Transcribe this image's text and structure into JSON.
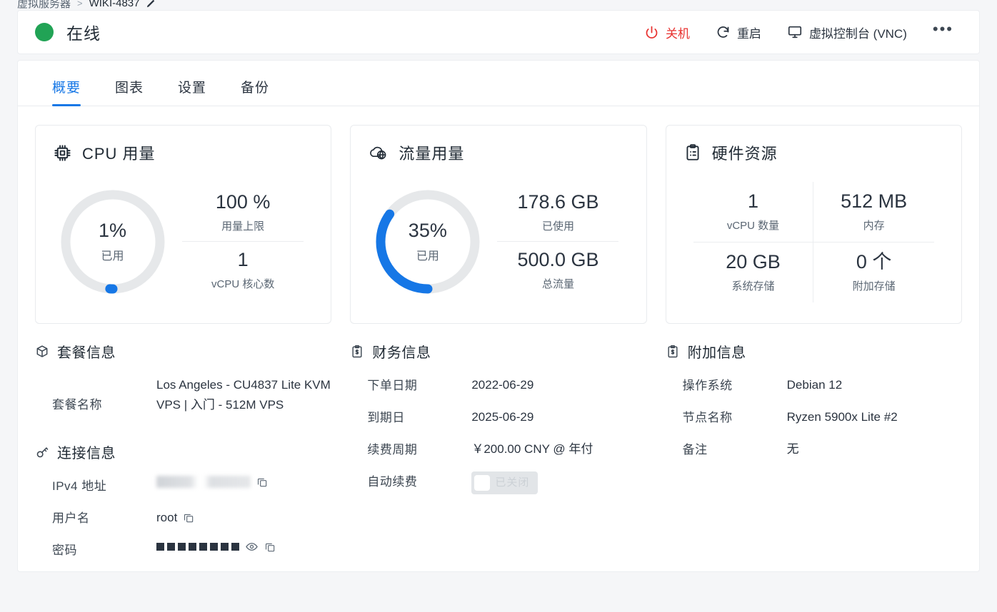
{
  "breadcrumb": {
    "parent": "虚拟服务器",
    "separator": ">",
    "current": "WIKI-4837",
    "edit_icon": "pencil-icon"
  },
  "status": {
    "state_label": "在线",
    "state_color": "#21a355",
    "actions": [
      {
        "label": "关机",
        "icon": "power-icon",
        "color": "#e8312f"
      },
      {
        "label": "重启",
        "icon": "refresh-icon",
        "color": "#2b3440"
      },
      {
        "label": "虚拟控制台 (VNC)",
        "icon": "monitor-icon",
        "color": "#2b3440"
      }
    ],
    "more_label": "•••"
  },
  "tabs": [
    {
      "label": "概要",
      "active": true
    },
    {
      "label": "图表",
      "active": false
    },
    {
      "label": "设置",
      "active": false
    },
    {
      "label": "备份",
      "active": false
    }
  ],
  "cards": {
    "cpu": {
      "title": "CPU 用量",
      "icon": "cpu-chip-icon",
      "donut": {
        "percent_text": "1%",
        "percent": 1,
        "caption": "已用",
        "color": "#1677e6",
        "track": "#e6e8ea"
      },
      "stats": [
        {
          "value": "100 %",
          "caption": "用量上限"
        },
        {
          "value": "1",
          "caption": "vCPU 核心数"
        }
      ]
    },
    "traffic": {
      "title": "流量用量",
      "icon": "cloud-globe-icon",
      "donut": {
        "percent_text": "35%",
        "percent": 35,
        "caption": "已用",
        "color": "#1677e6",
        "track": "#e6e8ea"
      },
      "stats": [
        {
          "value": "178.6 GB",
          "caption": "已使用"
        },
        {
          "value": "500.0 GB",
          "caption": "总流量"
        }
      ]
    },
    "hardware": {
      "title": "硬件资源",
      "icon": "clipboard-list-icon",
      "cells": [
        {
          "value": "1",
          "caption": "vCPU 数量"
        },
        {
          "value": "512 MB",
          "caption": "内存"
        },
        {
          "value": "20 GB",
          "caption": "系统存储"
        },
        {
          "value": "0 个",
          "caption": "附加存储"
        }
      ]
    }
  },
  "sections": {
    "package": {
      "title": "套餐信息",
      "icon": "package-box-icon",
      "rows": [
        {
          "key": "套餐名称",
          "value": "Los Angeles - CU4837 Lite KVM VPS | 入门 - 512M VPS"
        }
      ]
    },
    "connection": {
      "title": "连接信息",
      "icon": "key-icon",
      "rows": [
        {
          "key": "IPv4 地址",
          "value": "",
          "redacted": true,
          "copy_icon": "copy-icon"
        },
        {
          "key": "用户名",
          "value": "root",
          "copy_icon": "copy-icon"
        },
        {
          "key": "密码",
          "value": "••••••••",
          "masked_count": 8,
          "eye_icon": "eye-icon",
          "copy_icon": "copy-icon"
        }
      ]
    },
    "finance": {
      "title": "财务信息",
      "icon": "clipboard-dollar-icon",
      "rows": [
        {
          "key": "下单日期",
          "value": "2022-06-29"
        },
        {
          "key": "到期日",
          "value": "2025-06-29"
        },
        {
          "key": "续费周期",
          "value": "￥200.00 CNY @ 年付"
        },
        {
          "key": "自动续费",
          "value": "",
          "toggle": {
            "state_label": "已关闭",
            "on": false
          }
        }
      ]
    },
    "extra": {
      "title": "附加信息",
      "icon": "clipboard-dollar-icon",
      "rows": [
        {
          "key": "操作系统",
          "value": "Debian 12"
        },
        {
          "key": "节点名称",
          "value": "Ryzen 5900x Lite #2"
        },
        {
          "key": "备注",
          "value": "无"
        }
      ]
    }
  }
}
